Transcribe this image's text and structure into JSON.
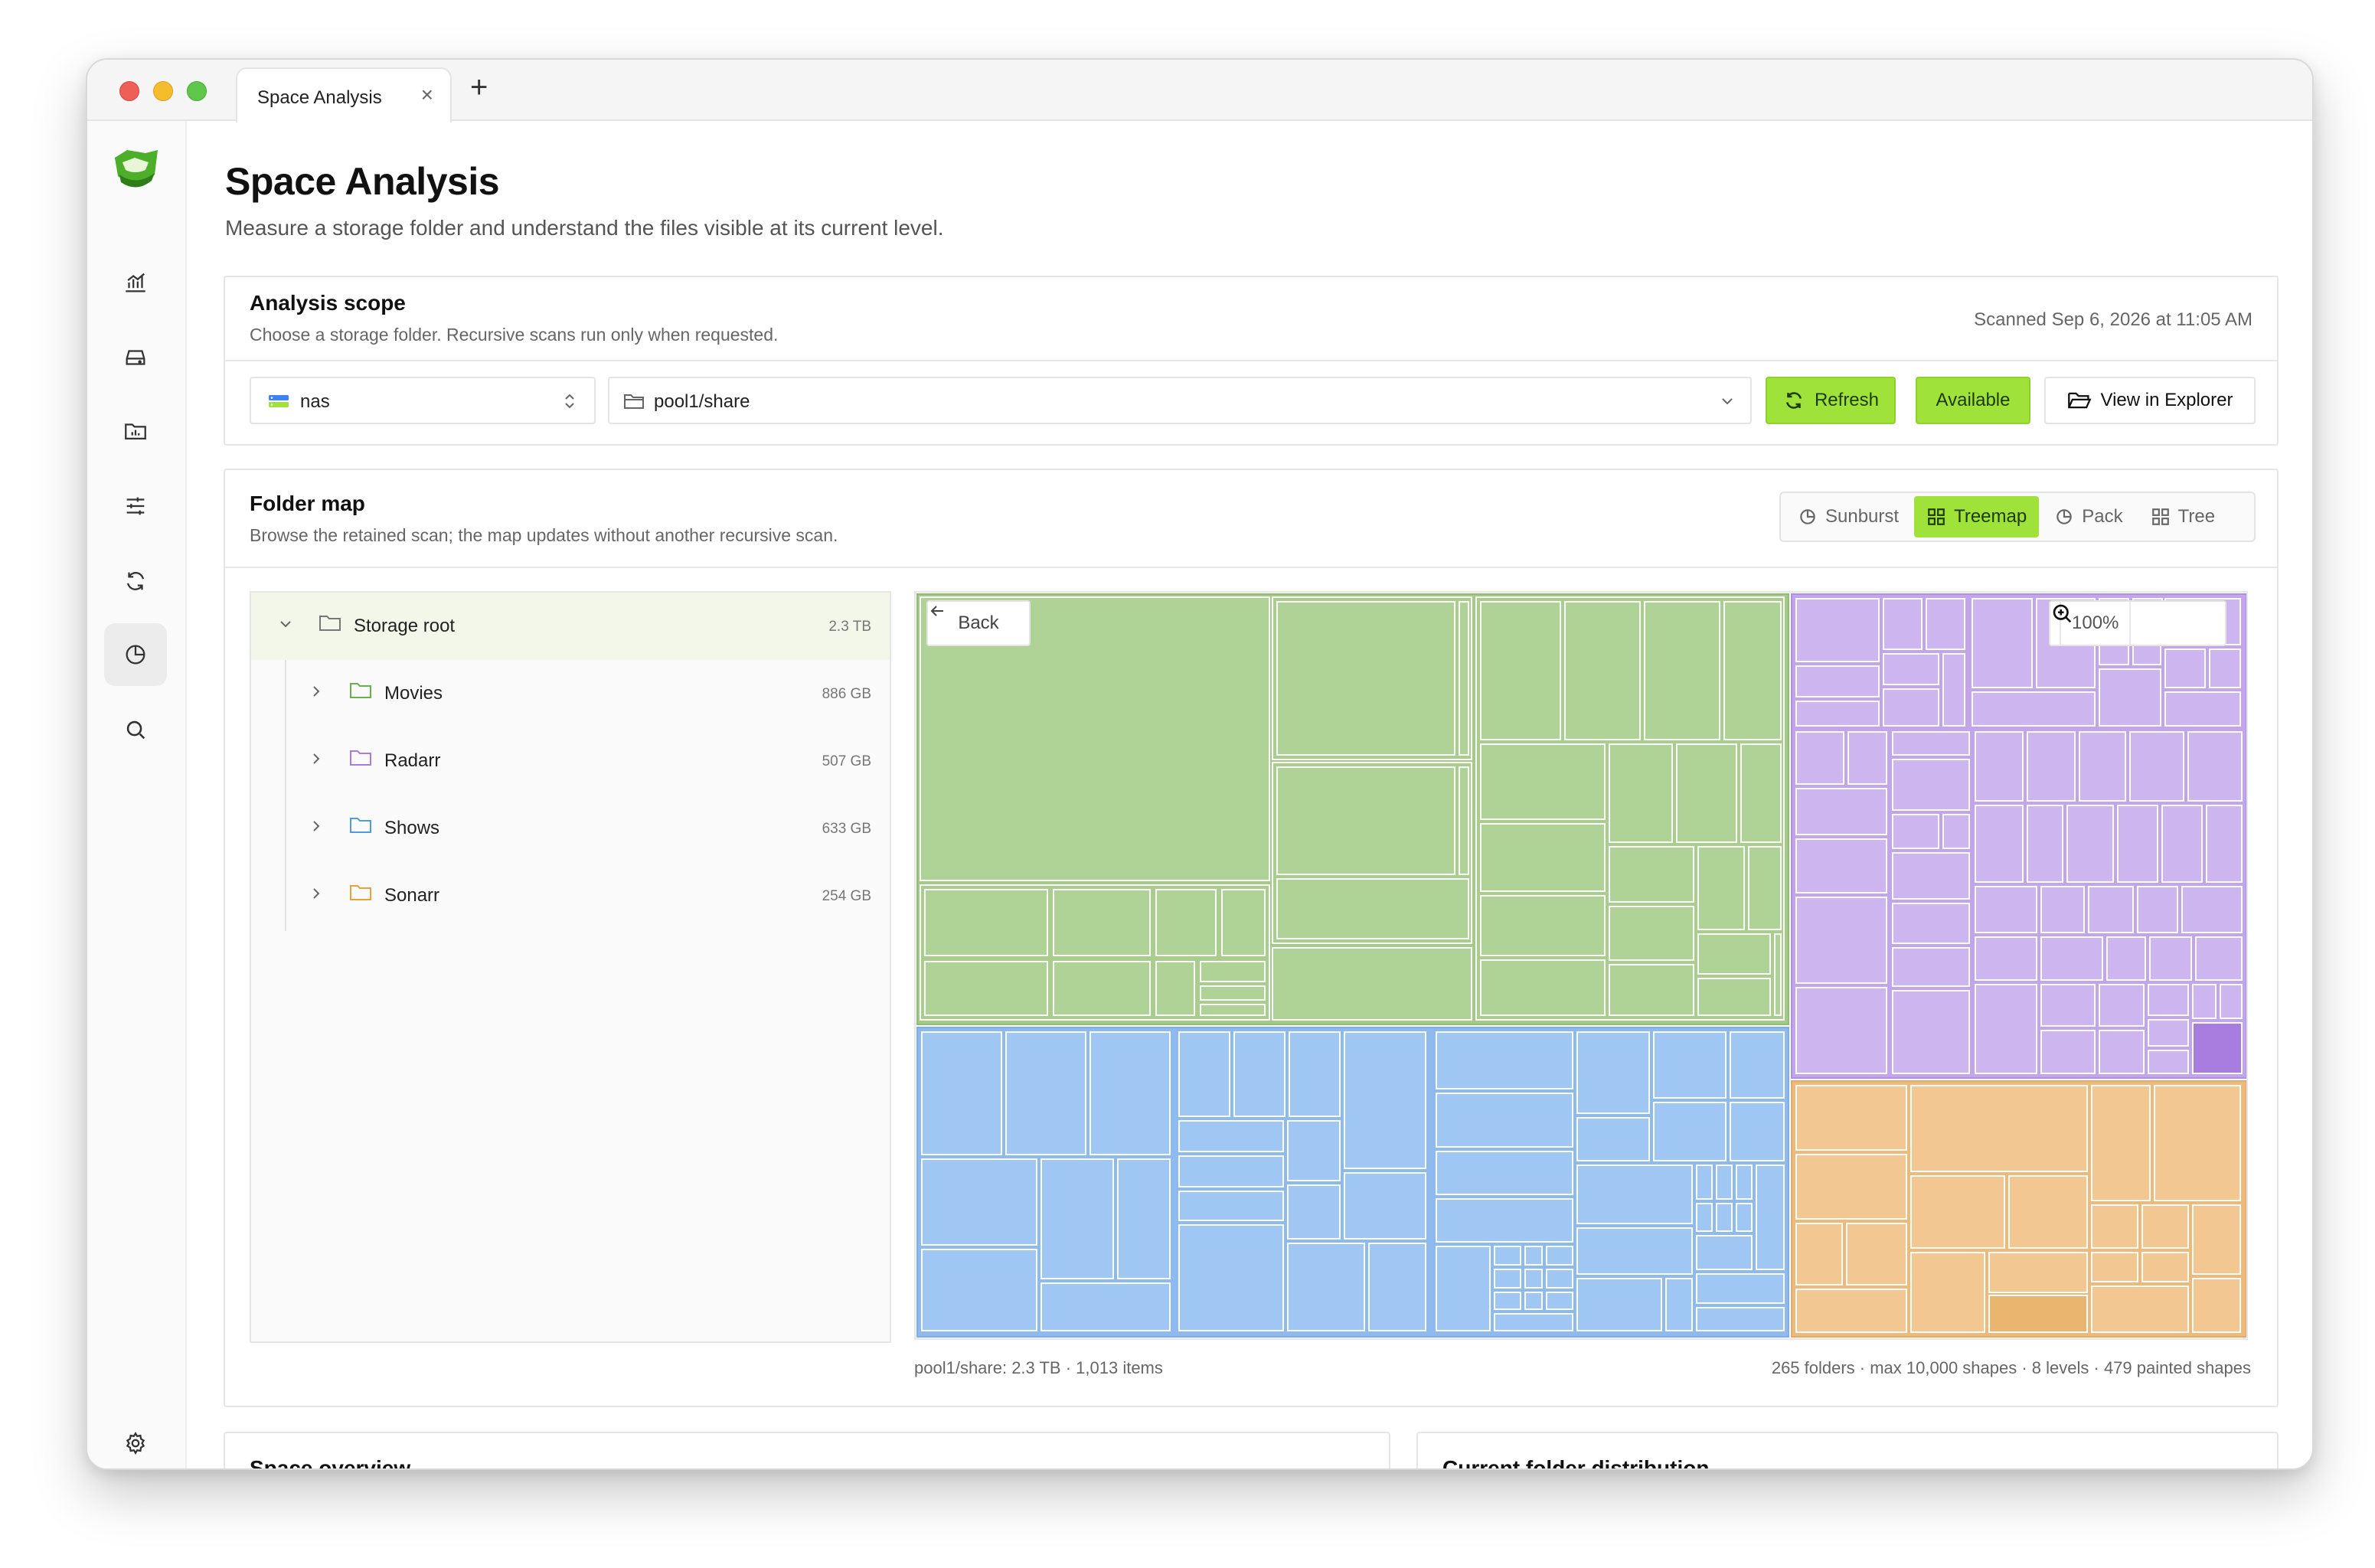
{
  "window": {
    "tab_title": "Space Analysis",
    "tab_close": "×",
    "tab_add": "+"
  },
  "sidebar": {
    "items": [
      {
        "name": "analytics-icon"
      },
      {
        "name": "drive-icon"
      },
      {
        "name": "folder-chart-icon"
      },
      {
        "name": "sliders-icon"
      },
      {
        "name": "sync-icon"
      },
      {
        "name": "pie-chart-icon",
        "active": true
      },
      {
        "name": "search-icon"
      }
    ],
    "settings_icon": "gear-icon"
  },
  "page": {
    "title": "Space Analysis",
    "subtitle": "Measure a storage folder and understand the files visible at its current level."
  },
  "scope": {
    "title": "Analysis scope",
    "subtitle": "Choose a storage folder. Recursive scans run only when requested.",
    "scanned": "Scanned Sep 6, 2026 at 11:05 AM",
    "storage_value": "nas",
    "folder_value": "pool1/share",
    "refresh_label": "Refresh",
    "available_label": "Available",
    "explorer_label": "View in Explorer"
  },
  "folder_map": {
    "title": "Folder map",
    "subtitle": "Browse the retained scan; the map updates without another recursive scan.",
    "views": [
      {
        "label": "Sunburst",
        "active": false
      },
      {
        "label": "Treemap",
        "active": true
      },
      {
        "label": "Pack",
        "active": false
      },
      {
        "label": "Tree",
        "active": false
      }
    ],
    "tree": {
      "root": {
        "name": "Storage root",
        "size": "2.3 TB"
      },
      "children": [
        {
          "name": "Movies",
          "size": "886 GB",
          "color": "#6ab04c"
        },
        {
          "name": "Radarr",
          "size": "507 GB",
          "color": "#a77de0"
        },
        {
          "name": "Shows",
          "size": "633 GB",
          "color": "#4f9be0"
        },
        {
          "name": "Sonarr",
          "size": "254 GB",
          "color": "#e8a23a"
        }
      ]
    },
    "back_label": "Back",
    "zoom": "100%",
    "footer_left": "pool1/share: 2.3 TB · 1,013 items",
    "footer_right": "265 folders · max 10,000 shapes · 8 levels · 479 painted shapes",
    "colors": {
      "Movies": "#afd296",
      "Radarr": "#cdb5f0",
      "Shows": "#a0c6f3",
      "Sonarr": "#f2c792"
    }
  },
  "bottom_cards": {
    "left_title": "Space overview",
    "right_title": "Current folder distribution"
  }
}
